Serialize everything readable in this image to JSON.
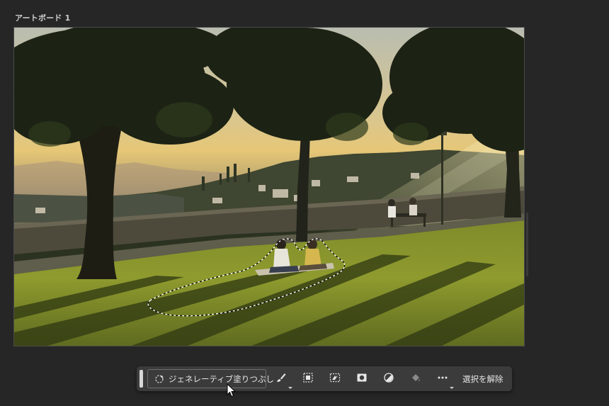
{
  "artboard": {
    "label": "アートボード 1"
  },
  "taskbar": {
    "generative_fill_label": "ジェネレーティブ塗りつぶし",
    "deselect_label": "選択を解除",
    "tools": [
      {
        "name": "brush-icon",
        "has_caret": true
      },
      {
        "name": "transform-selection-icon",
        "has_caret": false
      },
      {
        "name": "invert-selection-icon",
        "has_caret": false
      },
      {
        "name": "mask-icon",
        "has_caret": false
      },
      {
        "name": "adjustment-icon",
        "has_caret": false
      },
      {
        "name": "fill-icon",
        "has_caret": false
      },
      {
        "name": "more-icon",
        "has_caret": true
      }
    ]
  },
  "colors": {
    "app_background": "#262626",
    "taskbar_background": "#3b3b3b",
    "text": "#e6e6e6"
  }
}
